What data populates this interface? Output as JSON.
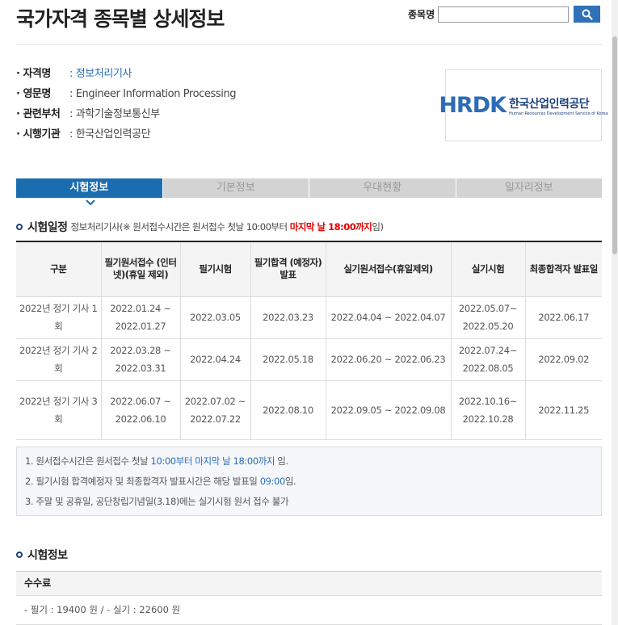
{
  "page_title": "국가자격 종목별 상세정보",
  "search": {
    "label": "종목명",
    "value": "",
    "placeholder": "",
    "icon": "search-icon"
  },
  "info": [
    {
      "key": "· 자격명",
      "value": ": 정보처리기사"
    },
    {
      "key": "· 영문명",
      "value": ": Engineer Information Processing"
    },
    {
      "key": "· 관련부처",
      "value": ": 과학기술정보통신부"
    },
    {
      "key": "· 시행기관",
      "value": ": 한국산업인력공단"
    }
  ],
  "logo": {
    "mark": "HRDK",
    "name_kor": "한국산업인력공단",
    "name_eng": "Human Resources Development Service of Korea"
  },
  "tabs": [
    "시험정보",
    "기본정보",
    "우대현황",
    "일자리정보"
  ],
  "active_tab": "시험정보",
  "schedule": {
    "title": "시험일정",
    "sub_prefix": "정보처리기사(※ 원서접수시간은 원서접수 첫날 10:00부터 ",
    "sub_red": "마지막 날 18:00까지",
    "sub_suffix": "임)",
    "headers": [
      "구분",
      "필기원서접수 (인터넷)(휴일 제외)",
      "필기시험",
      "필기합격 (예정자)발표",
      "실기원서접수(휴일제외)",
      "실기시험",
      "최종합격자 발표일"
    ],
    "rows": [
      [
        "2022년 정기 기사 1회",
        "2022.01.24 ~ 2022.01.27",
        "2022.03.05",
        "2022.03.23",
        "2022.04.04 ~ 2022.04.07",
        "2022.05.07~ 2022.05.20",
        "2022.06.17"
      ],
      [
        "2022년 정기 기사 2회",
        "2022.03.28 ~ 2022.03.31",
        "2022.04.24",
        "2022.05.18",
        "2022.06.20 ~ 2022.06.23",
        "2022.07.24~ 2022.08.05",
        "2022.09.02"
      ],
      [
        "2022년 정기 기사 3회",
        "2022.06.07 ~ 2022.06.10",
        "2022.07.02 ~ 2022.07.22",
        "2022.08.10",
        "2022.09.05 ~ 2022.09.08",
        "2022.10.16~ 2022.10.28",
        "2022.11.25"
      ]
    ]
  },
  "notes": [
    {
      "pre": "1. 원서접수시간은 원서접수 첫날 ",
      "blue": "10:00부터 마지막 날 18:00까지",
      "post": " 임."
    },
    {
      "pre": "2. 필기시험 합격예정자 및 최종합격자 발표시간은 해당 발표일 ",
      "blue": "09:00",
      "post": "임."
    },
    {
      "pre": "3. 주말 및 공휴일, 공단창립기념일(3.18)에는 실기시험 원서 접수 불가",
      "blue": "",
      "post": ""
    }
  ],
  "exam_info": {
    "title": "시험정보",
    "fee_label": "수수료",
    "fee_value": "- 필기 : 19400 원 / - 실기 : 22600 원"
  },
  "colors": {
    "primary": "#1c6db0",
    "search_button": "#2f70b8",
    "highlight_red": "#e40000",
    "link_blue": "#2a6db8"
  }
}
